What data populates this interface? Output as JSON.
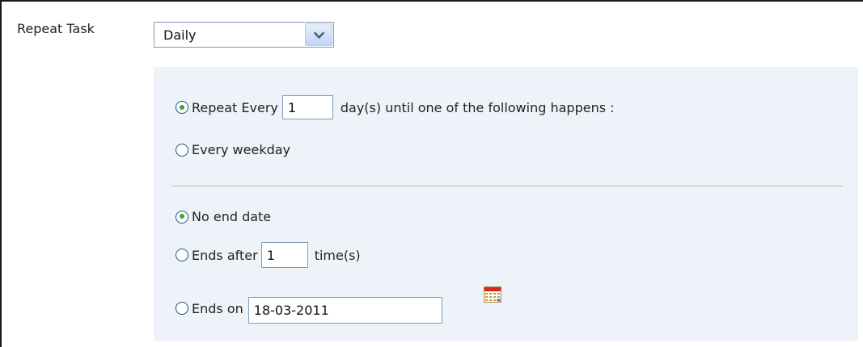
{
  "repeat_task": {
    "label": "Repeat Task",
    "frequency_selected": "Daily"
  },
  "recurrence": {
    "repeat_every": {
      "checked": true,
      "prefix": "Repeat Every",
      "value": "1",
      "suffix": "day(s) until one of the following happens :"
    },
    "every_weekday": {
      "checked": false,
      "label": "Every weekday"
    }
  },
  "end_condition": {
    "no_end_date": {
      "checked": true,
      "label": "No end date"
    },
    "ends_after": {
      "checked": false,
      "prefix": "Ends after",
      "value": "1",
      "suffix": "time(s)"
    },
    "ends_on": {
      "checked": false,
      "prefix": "Ends on",
      "value": "18-03-2011",
      "icon": "calendar-icon"
    }
  },
  "colors": {
    "panel_background": "#eef3fa",
    "radio_checked_dot": "#31a93a",
    "input_border": "#7f9db9"
  }
}
